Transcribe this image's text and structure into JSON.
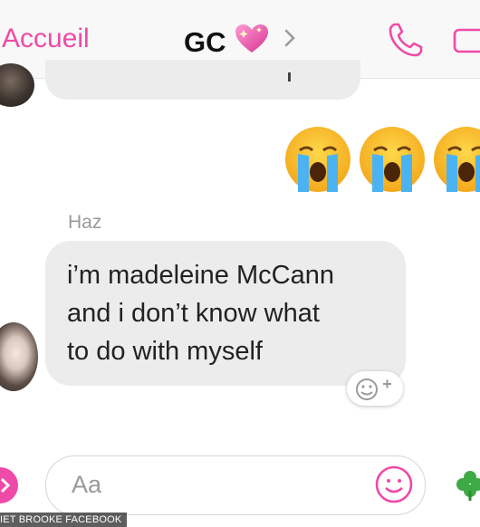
{
  "header": {
    "back_label": "Accueil",
    "title": "GC",
    "title_emoji": "💖"
  },
  "thread": {
    "reaction_emojis": [
      "crying-face",
      "crying-face",
      "crying-face"
    ],
    "sender_name": "Haz",
    "message_lines": [
      "i’m madeleine McCann",
      "and i don’t know what",
      "to do with myself"
    ]
  },
  "composer": {
    "placeholder": "Aa"
  },
  "watermark": {
    "text": "IET BROOKE FACEBOOK"
  },
  "colors": {
    "accent": "#ef4aa8",
    "bubble": "#ececec",
    "header_bg": "#f8f8f8"
  }
}
